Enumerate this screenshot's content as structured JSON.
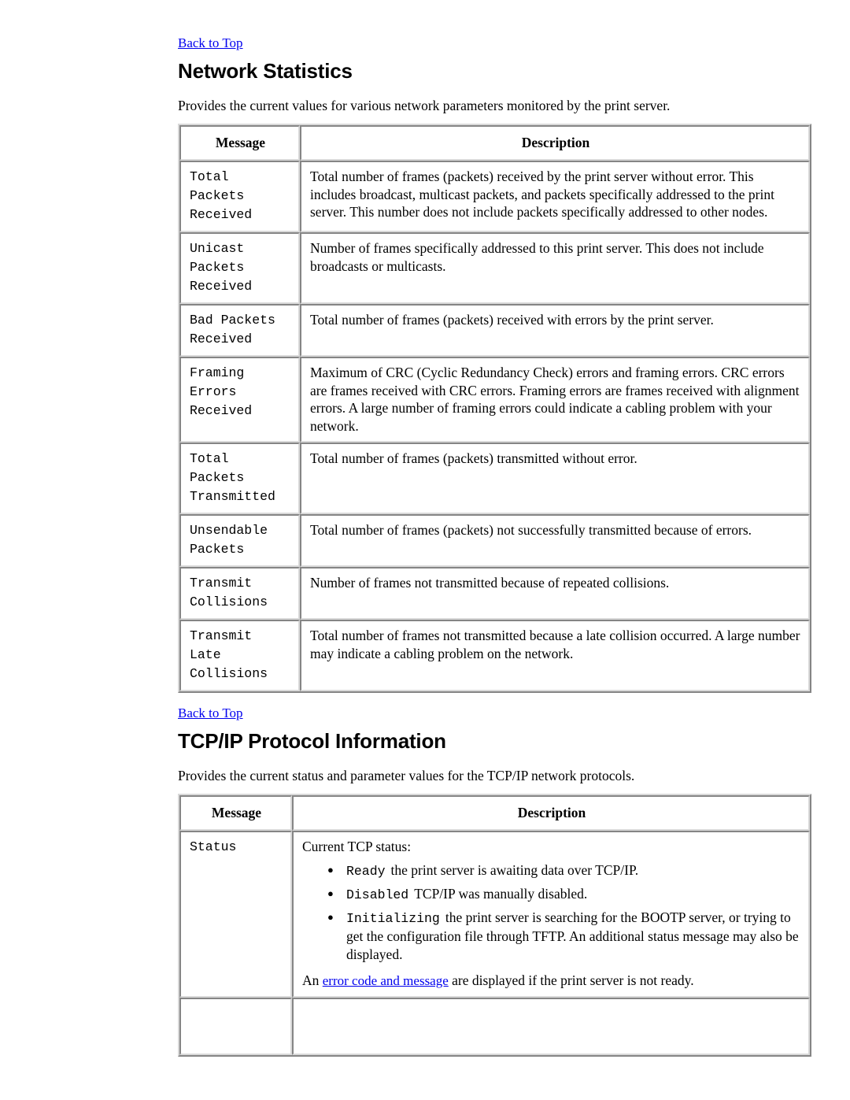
{
  "links": {
    "back_to_top": "Back to Top",
    "error_code_and_message": "error code and message"
  },
  "colors": {
    "link": "#0000ee",
    "text": "#000000",
    "background": "#ffffff",
    "table_border": "#d9d9d9"
  },
  "sections": [
    {
      "id": "network-statistics",
      "heading": "Network Statistics",
      "intro": "Provides the current values for various network parameters monitored by the print server.",
      "table": {
        "headers": {
          "message": "Message",
          "description": "Description"
        },
        "rows": [
          {
            "message": "Total\nPackets\nReceived",
            "description": "Total number of frames (packets) received by the print server without error. This includes broadcast, multicast packets, and packets specifically addressed to the print server. This number does not include packets specifically addressed to other nodes."
          },
          {
            "message": "Unicast\nPackets\nReceived",
            "description": "Number of frames specifically addressed to this print server. This does not include broadcasts or multicasts."
          },
          {
            "message": "Bad Packets\nReceived",
            "description": "Total number of frames (packets) received with errors by the print server."
          },
          {
            "message": "Framing\nErrors\nReceived",
            "description": "Maximum of CRC (Cyclic Redundancy Check) errors and framing errors. CRC errors are frames received with CRC errors. Framing errors are frames received with alignment errors. A large number of framing errors could indicate a cabling problem with your network."
          },
          {
            "message": "Total\nPackets\nTransmitted",
            "description": "Total number of frames (packets) transmitted without error."
          },
          {
            "message": "Unsendable\nPackets",
            "description": "Total number of frames (packets) not successfully transmitted because of errors."
          },
          {
            "message": "Transmit\nCollisions",
            "description": "Number of frames not transmitted because of repeated collisions."
          },
          {
            "message": "Transmit\nLate\nCollisions",
            "description": "Total number of frames not transmitted because a late collision occurred. A large number may indicate a cabling problem on the network."
          }
        ]
      }
    },
    {
      "id": "tcpip-protocol-information",
      "heading": "TCP/IP Protocol Information",
      "intro": "Provides the current status and parameter values for the TCP/IP network protocols.",
      "table": {
        "headers": {
          "message": "Message",
          "description": "Description"
        },
        "status_row": {
          "message": "Status",
          "lead": "Current TCP status:",
          "bullets": [
            {
              "keyword": "Ready",
              "text": "the print server is awaiting data over TCP/IP."
            },
            {
              "keyword": "Disabled",
              "text": "TCP/IP was manually disabled."
            },
            {
              "keyword": "Initializing",
              "text": "the print server is searching for the BOOTP server, or trying to get the configuration file through TFTP. An additional status message may also be displayed."
            }
          ],
          "footer_prefix": "An ",
          "footer_suffix": " are displayed if the print server is not ready."
        }
      }
    }
  ]
}
